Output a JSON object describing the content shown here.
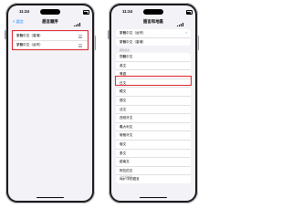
{
  "status_bar": {
    "time": "11:24"
  },
  "left": {
    "back_label": "< 語言",
    "title": "語言順序",
    "items": [
      {
        "label": "繁體中文（香港）"
      },
      {
        "label": "繁體中文（台灣）"
      }
    ]
  },
  "right": {
    "title": "語言和地區",
    "top_group": [
      {
        "label": "繁體中文（台灣）",
        "checked": true
      },
      {
        "label": "繁體中文（香港）",
        "checked": false
      }
    ],
    "section_header": "其他語言",
    "list": [
      "簡體中文",
      "英文",
      "粵語",
      "日文",
      "韓文",
      "德文",
      "法文",
      "西班牙文",
      "義大利文",
      "葡萄牙文",
      "俄文",
      "泰文",
      "越南文",
      "阿拉伯文",
      "App 中的語言"
    ],
    "footer": "語言和地區"
  },
  "colors": {
    "accent": "#0a84ff",
    "highlight": "#e0242e",
    "background": "#f2f2f7"
  }
}
